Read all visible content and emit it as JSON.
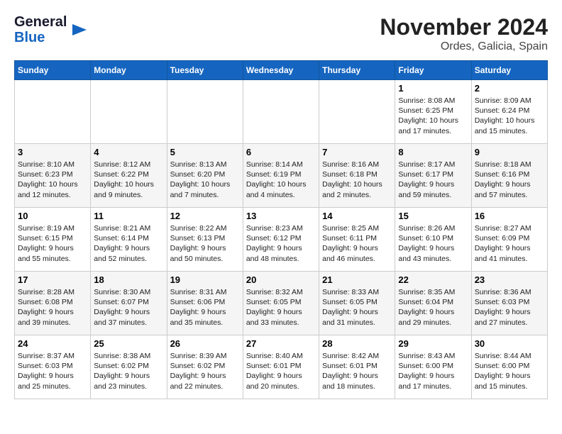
{
  "header": {
    "logo_line1": "General",
    "logo_line2": "Blue",
    "month": "November 2024",
    "location": "Ordes, Galicia, Spain"
  },
  "columns": [
    "Sunday",
    "Monday",
    "Tuesday",
    "Wednesday",
    "Thursday",
    "Friday",
    "Saturday"
  ],
  "weeks": [
    [
      {
        "day": "",
        "info": ""
      },
      {
        "day": "",
        "info": ""
      },
      {
        "day": "",
        "info": ""
      },
      {
        "day": "",
        "info": ""
      },
      {
        "day": "",
        "info": ""
      },
      {
        "day": "1",
        "info": "Sunrise: 8:08 AM\nSunset: 6:25 PM\nDaylight: 10 hours and 17 minutes."
      },
      {
        "day": "2",
        "info": "Sunrise: 8:09 AM\nSunset: 6:24 PM\nDaylight: 10 hours and 15 minutes."
      }
    ],
    [
      {
        "day": "3",
        "info": "Sunrise: 8:10 AM\nSunset: 6:23 PM\nDaylight: 10 hours and 12 minutes."
      },
      {
        "day": "4",
        "info": "Sunrise: 8:12 AM\nSunset: 6:22 PM\nDaylight: 10 hours and 9 minutes."
      },
      {
        "day": "5",
        "info": "Sunrise: 8:13 AM\nSunset: 6:20 PM\nDaylight: 10 hours and 7 minutes."
      },
      {
        "day": "6",
        "info": "Sunrise: 8:14 AM\nSunset: 6:19 PM\nDaylight: 10 hours and 4 minutes."
      },
      {
        "day": "7",
        "info": "Sunrise: 8:16 AM\nSunset: 6:18 PM\nDaylight: 10 hours and 2 minutes."
      },
      {
        "day": "8",
        "info": "Sunrise: 8:17 AM\nSunset: 6:17 PM\nDaylight: 9 hours and 59 minutes."
      },
      {
        "day": "9",
        "info": "Sunrise: 8:18 AM\nSunset: 6:16 PM\nDaylight: 9 hours and 57 minutes."
      }
    ],
    [
      {
        "day": "10",
        "info": "Sunrise: 8:19 AM\nSunset: 6:15 PM\nDaylight: 9 hours and 55 minutes."
      },
      {
        "day": "11",
        "info": "Sunrise: 8:21 AM\nSunset: 6:14 PM\nDaylight: 9 hours and 52 minutes."
      },
      {
        "day": "12",
        "info": "Sunrise: 8:22 AM\nSunset: 6:13 PM\nDaylight: 9 hours and 50 minutes."
      },
      {
        "day": "13",
        "info": "Sunrise: 8:23 AM\nSunset: 6:12 PM\nDaylight: 9 hours and 48 minutes."
      },
      {
        "day": "14",
        "info": "Sunrise: 8:25 AM\nSunset: 6:11 PM\nDaylight: 9 hours and 46 minutes."
      },
      {
        "day": "15",
        "info": "Sunrise: 8:26 AM\nSunset: 6:10 PM\nDaylight: 9 hours and 43 minutes."
      },
      {
        "day": "16",
        "info": "Sunrise: 8:27 AM\nSunset: 6:09 PM\nDaylight: 9 hours and 41 minutes."
      }
    ],
    [
      {
        "day": "17",
        "info": "Sunrise: 8:28 AM\nSunset: 6:08 PM\nDaylight: 9 hours and 39 minutes."
      },
      {
        "day": "18",
        "info": "Sunrise: 8:30 AM\nSunset: 6:07 PM\nDaylight: 9 hours and 37 minutes."
      },
      {
        "day": "19",
        "info": "Sunrise: 8:31 AM\nSunset: 6:06 PM\nDaylight: 9 hours and 35 minutes."
      },
      {
        "day": "20",
        "info": "Sunrise: 8:32 AM\nSunset: 6:05 PM\nDaylight: 9 hours and 33 minutes."
      },
      {
        "day": "21",
        "info": "Sunrise: 8:33 AM\nSunset: 6:05 PM\nDaylight: 9 hours and 31 minutes."
      },
      {
        "day": "22",
        "info": "Sunrise: 8:35 AM\nSunset: 6:04 PM\nDaylight: 9 hours and 29 minutes."
      },
      {
        "day": "23",
        "info": "Sunrise: 8:36 AM\nSunset: 6:03 PM\nDaylight: 9 hours and 27 minutes."
      }
    ],
    [
      {
        "day": "24",
        "info": "Sunrise: 8:37 AM\nSunset: 6:03 PM\nDaylight: 9 hours and 25 minutes."
      },
      {
        "day": "25",
        "info": "Sunrise: 8:38 AM\nSunset: 6:02 PM\nDaylight: 9 hours and 23 minutes."
      },
      {
        "day": "26",
        "info": "Sunrise: 8:39 AM\nSunset: 6:02 PM\nDaylight: 9 hours and 22 minutes."
      },
      {
        "day": "27",
        "info": "Sunrise: 8:40 AM\nSunset: 6:01 PM\nDaylight: 9 hours and 20 minutes."
      },
      {
        "day": "28",
        "info": "Sunrise: 8:42 AM\nSunset: 6:01 PM\nDaylight: 9 hours and 18 minutes."
      },
      {
        "day": "29",
        "info": "Sunrise: 8:43 AM\nSunset: 6:00 PM\nDaylight: 9 hours and 17 minutes."
      },
      {
        "day": "30",
        "info": "Sunrise: 8:44 AM\nSunset: 6:00 PM\nDaylight: 9 hours and 15 minutes."
      }
    ]
  ]
}
